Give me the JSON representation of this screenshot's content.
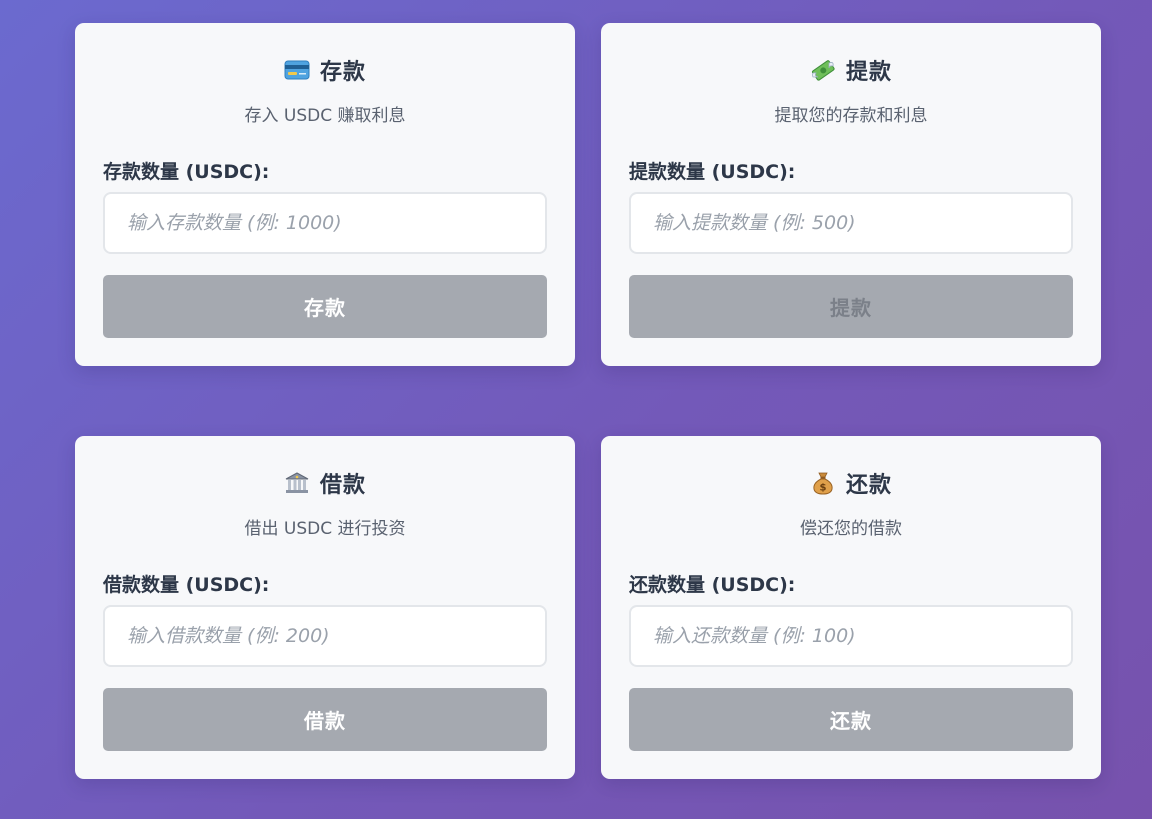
{
  "cards": [
    {
      "icon": "credit-card-icon",
      "title": "存款",
      "subtitle": "存入 USDC 赚取利息",
      "label": "存款数量 (USDC):",
      "placeholder": "输入存款数量 (例: 1000)",
      "value": "",
      "button": "存款"
    },
    {
      "icon": "money-wings-icon",
      "title": "提款",
      "subtitle": "提取您的存款和利息",
      "label": "提款数量 (USDC):",
      "placeholder": "输入提款数量 (例: 500)",
      "value": "",
      "button": "提款"
    },
    {
      "icon": "bank-icon",
      "title": "借款",
      "subtitle": "借出 USDC 进行投资",
      "label": "借款数量 (USDC):",
      "placeholder": "输入借款数量 (例: 200)",
      "value": "",
      "button": "借款"
    },
    {
      "icon": "money-bag-icon",
      "title": "还款",
      "subtitle": "偿还您的借款",
      "label": "还款数量 (USDC):",
      "placeholder": "输入还款数量 (例: 100)",
      "value": "",
      "button": "还款"
    }
  ],
  "colors": {
    "background_start": "#6b6acf",
    "background_end": "#7752ad",
    "card_bg": "#f7f8fa",
    "button_disabled": "#a5a9b0"
  }
}
